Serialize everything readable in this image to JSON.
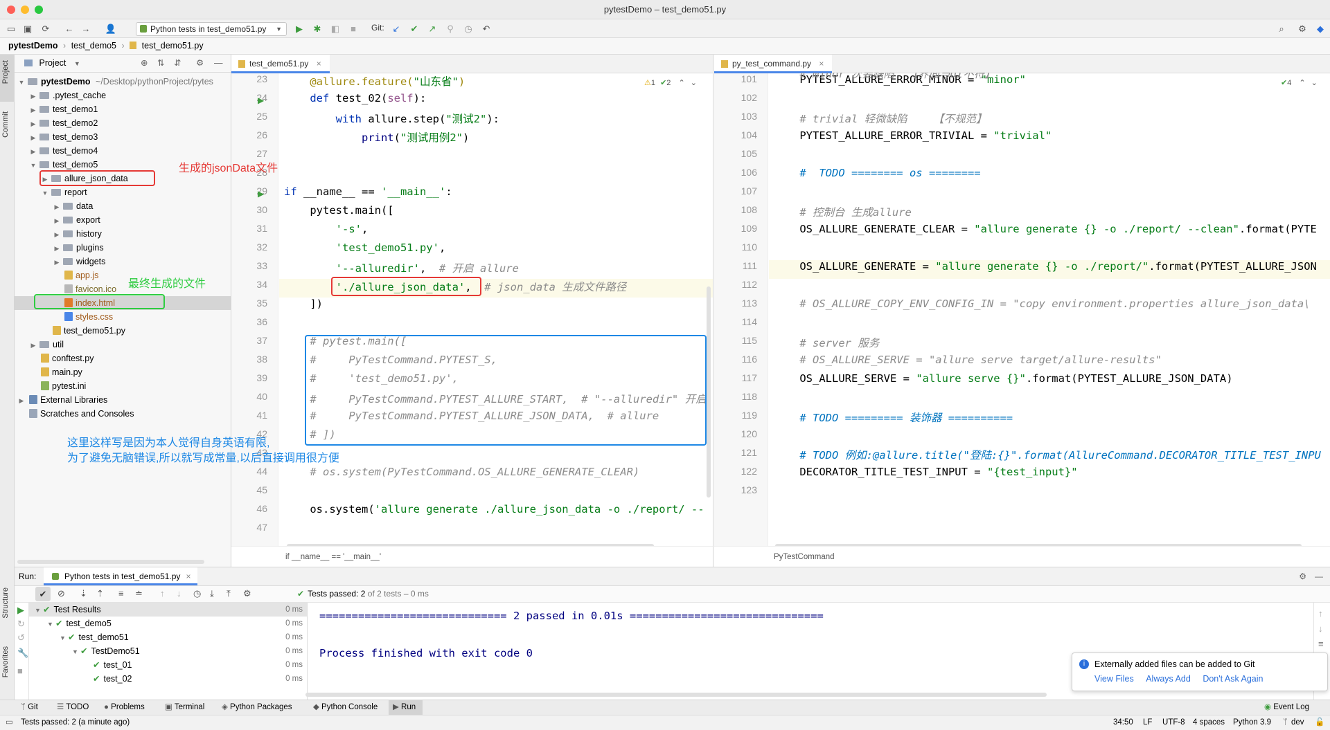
{
  "window": {
    "title": "pytestDemo – test_demo51.py"
  },
  "toolbar": {
    "run_config": "Python tests in test_demo51.py",
    "git_label": "Git:"
  },
  "breadcrumb": [
    "pytestDemo",
    "test_demo5",
    "test_demo51.py"
  ],
  "side_tabs": {
    "project": "Project",
    "commit": "Commit",
    "structure": "Structure",
    "favorites": "Favorites"
  },
  "project_panel": {
    "title": "Project",
    "root_name": "pytestDemo",
    "root_path": "~/Desktop/pythonProject/pytes",
    "items": [
      {
        "label": ".pytest_cache",
        "level": 1,
        "kind": "folder",
        "arrow": "closed"
      },
      {
        "label": "test_demo1",
        "level": 1,
        "kind": "folder",
        "arrow": "closed"
      },
      {
        "label": "test_demo2",
        "level": 1,
        "kind": "folder",
        "arrow": "closed"
      },
      {
        "label": "test_demo3",
        "level": 1,
        "kind": "folder",
        "arrow": "closed"
      },
      {
        "label": "test_demo4",
        "level": 1,
        "kind": "folder",
        "arrow": "closed"
      },
      {
        "label": "test_demo5",
        "level": 1,
        "kind": "folder",
        "arrow": "open"
      },
      {
        "label": "allure_json_data",
        "level": 2,
        "kind": "folder",
        "arrow": "closed"
      },
      {
        "label": "report",
        "level": 2,
        "kind": "folder",
        "arrow": "open"
      },
      {
        "label": "data",
        "level": 3,
        "kind": "folder",
        "arrow": "closed"
      },
      {
        "label": "export",
        "level": 3,
        "kind": "folder",
        "arrow": "closed"
      },
      {
        "label": "history",
        "level": 3,
        "kind": "folder",
        "arrow": "closed"
      },
      {
        "label": "plugins",
        "level": 3,
        "kind": "folder",
        "arrow": "closed"
      },
      {
        "label": "widgets",
        "level": 3,
        "kind": "folder",
        "arrow": "closed"
      },
      {
        "label": "app.js",
        "level": 3,
        "kind": "js",
        "arrow": ""
      },
      {
        "label": "favicon.ico",
        "level": 3,
        "kind": "ico",
        "arrow": ""
      },
      {
        "label": "index.html",
        "level": 3,
        "kind": "html",
        "arrow": ""
      },
      {
        "label": "styles.css",
        "level": 3,
        "kind": "css",
        "arrow": ""
      },
      {
        "label": "test_demo51.py",
        "level": 2,
        "kind": "py",
        "arrow": ""
      },
      {
        "label": "util",
        "level": 1,
        "kind": "folder",
        "arrow": "closed"
      },
      {
        "label": "conftest.py",
        "level": 1,
        "kind": "py",
        "arrow": ""
      },
      {
        "label": "main.py",
        "level": 1,
        "kind": "py",
        "arrow": ""
      },
      {
        "label": "pytest.ini",
        "level": 1,
        "kind": "ini",
        "arrow": ""
      },
      {
        "label": "External Libraries",
        "level": 0,
        "kind": "lib",
        "arrow": "closed"
      },
      {
        "label": "Scratches and Consoles",
        "level": 0,
        "kind": "scratch",
        "arrow": ""
      }
    ]
  },
  "annotations": {
    "json_data": "生成的jsonData文件",
    "final_file": "最终生成的文件",
    "note_line1": "这里这样写是因为本人觉得自身英语有限,",
    "note_line2": "为了避免无脑错误,所以就写成常量,以后直接调用很方便"
  },
  "editor_left": {
    "tab": "test_demo51.py",
    "inspections": {
      "warnings": "1",
      "weak": "2"
    },
    "breadcrumb": "if __name__ == '__main__'",
    "line_numbers": [
      "23",
      "24",
      "25",
      "26",
      "27",
      "28",
      "29",
      "30",
      "31",
      "32",
      "33",
      "34",
      "35",
      "36",
      "37",
      "38",
      "39",
      "40",
      "41",
      "42",
      "43",
      "44",
      "45",
      "46",
      "47"
    ],
    "lines": [
      {
        "t": [
          [
            "dc",
            "    @allure.feature("
          ],
          [
            "st",
            "\"山东省\""
          ],
          [
            "dc",
            ")"
          ]
        ]
      },
      {
        "t": [
          [
            "kw",
            "    def "
          ],
          [
            "",
            "test_02("
          ],
          [
            "sf",
            "self"
          ],
          [
            "",
            "):"
          ]
        ]
      },
      {
        "t": [
          [
            "kw",
            "        with "
          ],
          [
            "",
            "allure.step("
          ],
          [
            "st",
            "\"测试2\""
          ],
          [
            "",
            "):"
          ]
        ]
      },
      {
        "t": [
          [
            "nb",
            "            print"
          ],
          [
            "",
            "("
          ],
          [
            "st",
            "\"测试用例2\""
          ],
          [
            "",
            ")"
          ]
        ]
      },
      {
        "t": [
          [
            "",
            ""
          ]
        ]
      },
      {
        "t": [
          [
            "",
            ""
          ]
        ]
      },
      {
        "t": [
          [
            "kw",
            "if "
          ],
          [
            "",
            "__name__ == "
          ],
          [
            "st",
            "'__main__'"
          ],
          [
            "",
            ":"
          ]
        ]
      },
      {
        "t": [
          [
            "",
            "    pytest.main(["
          ]
        ]
      },
      {
        "t": [
          [
            "st",
            "        '-s'"
          ],
          [
            "",
            ","
          ]
        ]
      },
      {
        "t": [
          [
            "st",
            "        'test_demo51.py'"
          ],
          [
            "",
            ","
          ]
        ]
      },
      {
        "t": [
          [
            "st",
            "        '--alluredir'"
          ],
          [
            "",
            ",  "
          ],
          [
            "cm",
            "# 开启 allure"
          ]
        ]
      },
      {
        "t": [
          [
            "st",
            "        './allure_json_data'"
          ],
          [
            "",
            ",  "
          ],
          [
            "cm",
            "# json_data 生成文件路径"
          ]
        ]
      },
      {
        "t": [
          [
            "",
            "    ])"
          ]
        ]
      },
      {
        "t": [
          [
            "",
            ""
          ]
        ]
      },
      {
        "t": [
          [
            "cm",
            "    # pytest.main(["
          ]
        ]
      },
      {
        "t": [
          [
            "cm",
            "    #     PyTestCommand.PYTEST_S,"
          ]
        ]
      },
      {
        "t": [
          [
            "cm",
            "    #     'test_demo51.py',"
          ]
        ]
      },
      {
        "t": [
          [
            "cm",
            "    #     PyTestCommand.PYTEST_ALLURE_START,  # \"--alluredir\" 开启"
          ]
        ]
      },
      {
        "t": [
          [
            "cm",
            "    #     PyTestCommand.PYTEST_ALLURE_JSON_DATA,  # allure"
          ]
        ]
      },
      {
        "t": [
          [
            "cm",
            "    # ])"
          ]
        ]
      },
      {
        "t": [
          [
            "",
            ""
          ]
        ]
      },
      {
        "t": [
          [
            "cm",
            "    # os.system(PyTestCommand.OS_ALLURE_GENERATE_CLEAR)"
          ]
        ]
      },
      {
        "t": [
          [
            "",
            ""
          ]
        ]
      },
      {
        "t": [
          [
            "",
            "    os.system("
          ],
          [
            "st",
            "'allure generate ./allure_json_data -o ./report/ --"
          ]
        ]
      },
      {
        "t": [
          [
            "",
            ""
          ]
        ]
      }
    ]
  },
  "editor_right": {
    "tab": "py_test_command.py",
    "inspections": {
      "weak": "4"
    },
    "breadcrumb": "PyTestCommand",
    "line_numbers": [
      "101",
      "102",
      "103",
      "104",
      "105",
      "106",
      "107",
      "108",
      "109",
      "110",
      "111",
      "112",
      "113",
      "114",
      "115",
      "116",
      "117",
      "118",
      "119",
      "120",
      "121",
      "122",
      "123"
    ],
    "lines": [
      {
        "t": [
          [
            "",
            "    PYTEST_ALLURE_ERROR_MINOR = "
          ],
          [
            "st",
            "\"minor\""
          ]
        ]
      },
      {
        "t": [
          [
            "",
            ""
          ]
        ]
      },
      {
        "t": [
          [
            "cm",
            "    # trivial 轻微缺陷    【不规范】"
          ]
        ]
      },
      {
        "t": [
          [
            "",
            "    PYTEST_ALLURE_ERROR_TRIVIAL = "
          ],
          [
            "st",
            "\"trivial\""
          ]
        ]
      },
      {
        "t": [
          [
            "",
            ""
          ]
        ]
      },
      {
        "t": [
          [
            "td",
            "    #  TODO ======== os ========"
          ]
        ]
      },
      {
        "t": [
          [
            "",
            ""
          ]
        ]
      },
      {
        "t": [
          [
            "cm",
            "    # 控制台 生成allure"
          ]
        ]
      },
      {
        "t": [
          [
            "",
            "    OS_ALLURE_GENERATE_CLEAR = "
          ],
          [
            "st",
            "\"allure generate {} -o ./report/ --clean\""
          ],
          [
            "",
            ".format(PYTE"
          ]
        ]
      },
      {
        "t": [
          [
            "",
            ""
          ]
        ]
      },
      {
        "t": [
          [
            "",
            "    OS_ALLURE_GENERATE = "
          ],
          [
            "st",
            "\"allure generate {} -o ./report/\""
          ],
          [
            "",
            ".format(PYTEST_ALLURE_JSON"
          ]
        ]
      },
      {
        "t": [
          [
            "",
            ""
          ]
        ]
      },
      {
        "t": [
          [
            "cm",
            "    # OS_ALLURE_COPY_ENV_CONFIG_IN = \"copy environment.properties allure_json_data\\"
          ]
        ]
      },
      {
        "t": [
          [
            "",
            ""
          ]
        ]
      },
      {
        "t": [
          [
            "cm",
            "    # server 服务"
          ]
        ]
      },
      {
        "t": [
          [
            "cm",
            "    # OS_ALLURE_SERVE = \"allure serve target/allure-results\""
          ]
        ]
      },
      {
        "t": [
          [
            "",
            "    OS_ALLURE_SERVE = "
          ],
          [
            "st",
            "\"allure serve {}\""
          ],
          [
            "",
            ".format(PYTEST_ALLURE_JSON_DATA)"
          ]
        ]
      },
      {
        "t": [
          [
            "",
            ""
          ]
        ]
      },
      {
        "t": [
          [
            "td",
            "    # TODO ========= 装饰器 =========="
          ]
        ]
      },
      {
        "t": [
          [
            "",
            ""
          ]
        ]
      },
      {
        "t": [
          [
            "td",
            "    # TODO 例如:@allure.title(\"登陆:{}\".format(AllureCommand.DECORATOR_TITLE_TEST_INPU"
          ]
        ]
      },
      {
        "t": [
          [
            "",
            "    DECORATOR_TITLE_TEST_INPUT = "
          ],
          [
            "st",
            "\"{test_input}\""
          ]
        ]
      },
      {
        "t": [
          [
            "",
            ""
          ]
        ]
      }
    ],
    "partial_top_line": "    # minor 次要缺陷  【界面与UI不符】"
  },
  "run_panel": {
    "label": "Run:",
    "tab": "Python tests in test_demo51.py",
    "summary_bold": "Tests passed: 2",
    "summary_rest": " of 2 tests – 0 ms",
    "tree": [
      {
        "label": "Test Results",
        "level": 0,
        "time": "0 ms"
      },
      {
        "label": "test_demo5",
        "level": 1,
        "time": "0 ms"
      },
      {
        "label": "test_demo51",
        "level": 2,
        "time": "0 ms"
      },
      {
        "label": "TestDemo51",
        "level": 3,
        "time": "0 ms"
      },
      {
        "label": "test_01",
        "level": 4,
        "time": "0 ms"
      },
      {
        "label": "test_02",
        "level": 4,
        "time": "0 ms"
      }
    ],
    "console_line1": "============================= 2 passed in 0.01s ==============================",
    "console_line2": "Process finished with exit code 0"
  },
  "notification": {
    "message": "Externally added files can be added to Git",
    "actions": [
      "View Files",
      "Always Add",
      "Don't Ask Again"
    ]
  },
  "bottom_tabs": [
    "Git",
    "TODO",
    "Problems",
    "Terminal",
    "Python Packages",
    "Python Console",
    "Run"
  ],
  "event_log": "Event Log",
  "status": {
    "message": "Tests passed: 2 (a minute ago)",
    "position": "34:50",
    "line_sep": "LF",
    "encoding": "UTF-8",
    "indent": "4 spaces",
    "interpreter": "Python 3.9",
    "branch": "dev"
  },
  "colors": {
    "accent": "#4a86e8",
    "pass": "#3e9c3e",
    "anno_red": "#e53935",
    "anno_green": "#2ecc40",
    "anno_blue": "#1e88e5"
  }
}
